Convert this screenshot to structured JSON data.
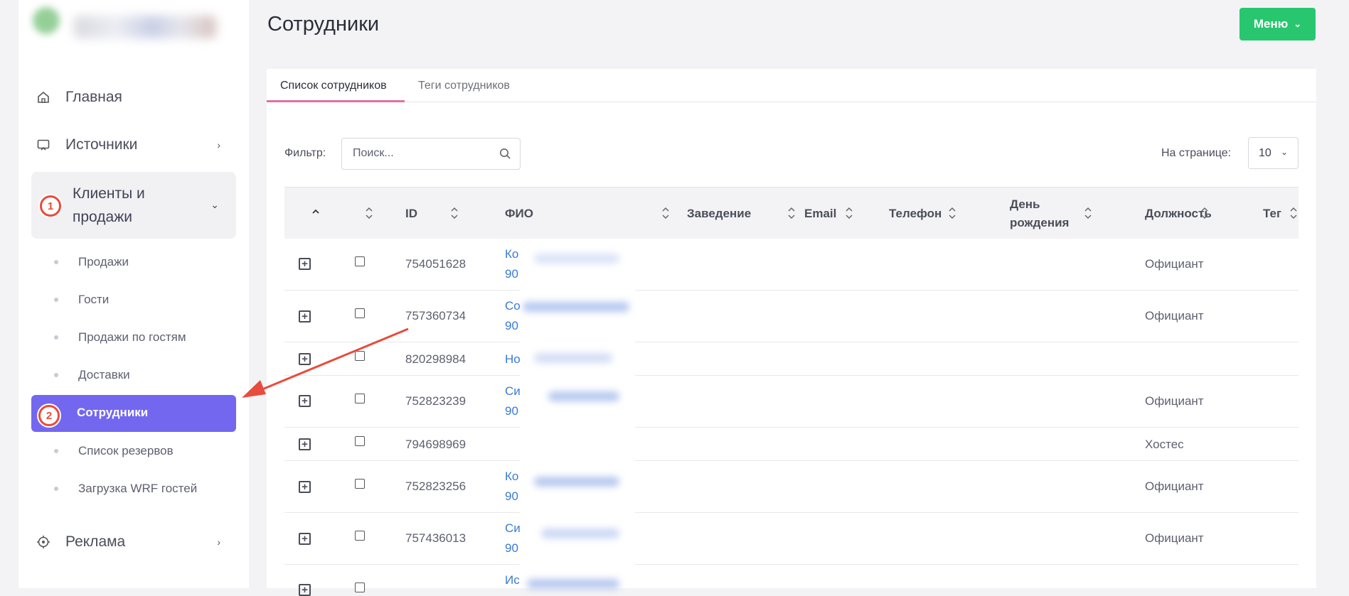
{
  "sidebar": {
    "items": [
      {
        "label": "Главная",
        "icon": "home-icon"
      },
      {
        "label": "Источники",
        "icon": "monitor-icon"
      },
      {
        "label": "Клиенты и продажи",
        "icon": "users-icon"
      },
      {
        "label": "Реклама",
        "icon": "target-icon"
      }
    ],
    "active_group_label": "Клиенты и продажи",
    "subitems": [
      "Продажи",
      "Гости",
      "Продажи по гостям",
      "Доставки",
      "Сотрудники",
      "Список резервов",
      "Загрузка WRF гостей"
    ],
    "active_subitem": "Сотрудники",
    "badge1": "1",
    "badge2": "2"
  },
  "header": {
    "title": "Сотрудники",
    "menu_label": "Меню"
  },
  "tabs": [
    "Список сотрудников",
    "Теги сотрудников"
  ],
  "filter": {
    "label": "Фильтр:",
    "placeholder": "Поиск...",
    "per_page_label": "На странице:",
    "per_page_value": "10"
  },
  "table": {
    "columns": [
      "ID",
      "ФИО",
      "Заведение",
      "Email",
      "Телефон",
      "День рождения",
      "Должность",
      "Тег"
    ],
    "rows": [
      {
        "id": "754051628",
        "fio1": "Ко",
        "fio2": "90",
        "position": "Официант"
      },
      {
        "id": "757360734",
        "fio1": "Со",
        "fio2": "90",
        "position": "Официант"
      },
      {
        "id": "820298984",
        "fio1": "Но",
        "fio2": "",
        "position": ""
      },
      {
        "id": "752823239",
        "fio1": "Си",
        "fio2": "90",
        "position": "Официант"
      },
      {
        "id": "794698969",
        "fio1": "",
        "fio2": "",
        "position": "Хостес"
      },
      {
        "id": "752823256",
        "fio1": "Ко",
        "fio2": "90",
        "position": "Официант"
      },
      {
        "id": "757436013",
        "fio1": "Си",
        "fio2": "90",
        "position": "Официант"
      },
      {
        "id": "",
        "fio1": "Ис",
        "fio2": "",
        "position": ""
      }
    ]
  },
  "colors": {
    "primary": "#7367f0",
    "success": "#28c76f",
    "tab_accent": "#e36ea3",
    "annotation": "#e74c3c",
    "link": "#3a7bd5"
  }
}
